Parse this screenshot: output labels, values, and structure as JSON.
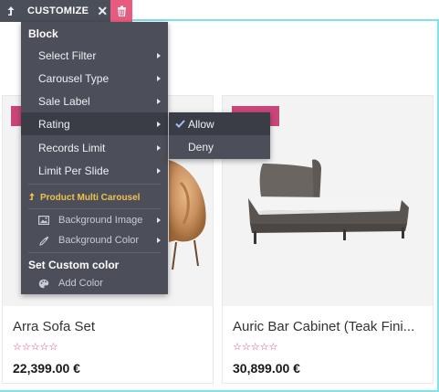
{
  "toolbar": {
    "up_icon": "level-up-icon",
    "title": "CUSTOMIZE",
    "close_glyph": "✕",
    "delete_icon": "trash-icon",
    "delete_color": "#e85b7f"
  },
  "menu": {
    "header": "Block",
    "items": [
      {
        "label": "Select Filter"
      },
      {
        "label": "Carousel Type"
      },
      {
        "label": "Sale Label"
      },
      {
        "label": "Rating"
      },
      {
        "label": "Records Limit"
      },
      {
        "label": "Limit Per Slide"
      }
    ],
    "section_label": "Product Multi Carousel",
    "section_color": "#f0c14d",
    "sub_items": [
      {
        "label": "Background Image",
        "icon": "image-icon"
      },
      {
        "label": "Background Color",
        "icon": "eyedropper-icon"
      }
    ],
    "custom_header": "Set Custom color",
    "add_color": {
      "label": "Add Color",
      "icon": "palette-icon"
    }
  },
  "submenu": {
    "options": [
      {
        "label": "Allow",
        "selected": true
      },
      {
        "label": "Deny",
        "selected": false
      }
    ]
  },
  "products": [
    {
      "title": "Arra Sofa Set",
      "price": "22,399.00 €",
      "rating_stars": "☆☆☆☆☆"
    },
    {
      "title": "Auric Bar Cabinet (Teak Fini...",
      "price": "30,899.00 €",
      "rating_stars": "☆☆☆☆☆"
    }
  ],
  "colors": {
    "accent": "#c9467a",
    "frame": "#7fe3ea",
    "menu_bg": "#4c4f59"
  }
}
